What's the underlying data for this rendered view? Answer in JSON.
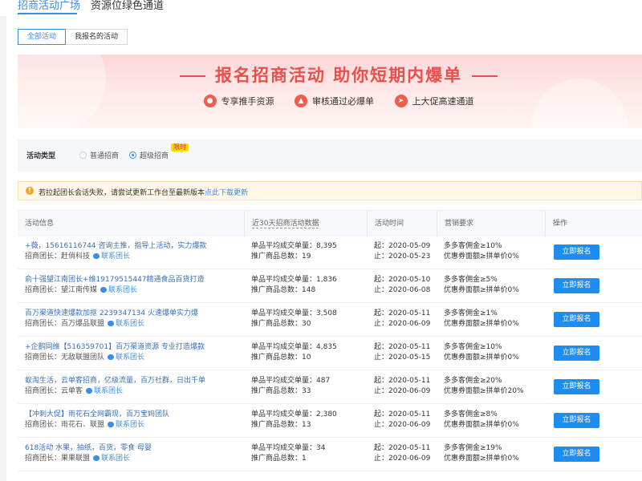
{
  "topnav": {
    "tabs": [
      {
        "label": "招商活动广场",
        "active": true
      },
      {
        "label": "资源位绿色通道",
        "active": false
      }
    ]
  },
  "subtabs": [
    {
      "label": "全部活动",
      "active": true
    },
    {
      "label": "我报名的活动",
      "active": false
    }
  ],
  "banner": {
    "title": "报名招商活动 助你短期内爆单",
    "features": [
      "专享推手资源",
      "审核通过必爆单",
      "上大促高速通道"
    ]
  },
  "activity_type": {
    "label": "活动类型",
    "options": [
      {
        "label": "普通招商",
        "selected": false
      },
      {
        "label": "超级招商",
        "selected": true
      }
    ],
    "badge": "限时"
  },
  "notice": {
    "text": "若拉起团长会话失败，请尝试更新工作台至最新版本",
    "link": "点此下载更新"
  },
  "table": {
    "headers": [
      "活动信息",
      "近30天招商活动数据",
      "活动时间",
      "营销要求",
      "操作"
    ],
    "contact_label": "联系团长",
    "apply_label": "立即报名",
    "leader_prefix": "招商团长：",
    "avg_prefix": "单品平均成交单量：",
    "total_prefix": "推广商品总数：",
    "start_prefix": "起：",
    "end_prefix": "止：",
    "rows": [
      {
        "title": "+薇，15616116744 咨询主推，指导上活动，实力爆款",
        "leader": "赶俏科技",
        "avg": "8,395",
        "total": "19",
        "start": "2020-05-09",
        "end": "2020-05-23",
        "req1": "多多客佣金≥10%",
        "req2": "优惠券面额≥拼单价0%"
      },
      {
        "title": "俞十强望江南团长+维19179515447精通食品百货打造",
        "leader": "望江南传媒",
        "avg": "1,836",
        "total": "148",
        "start": "2020-05-10",
        "end": "2020-06-08",
        "req1": "多多客佣金≥5%",
        "req2": "优惠券面额≥拼单价0%"
      },
      {
        "title": "百万渠道快速爆款加抠 2239347134 火速爆单实力爆",
        "leader": "百万爆品联盟",
        "avg": "3,508",
        "total": "30",
        "start": "2020-05-11",
        "end": "2020-06-09",
        "req1": "多多客佣金≥1%",
        "req2": "优惠券面额≥拼单价0%"
      },
      {
        "title": "+企鹅同维【516359701】百万渠道资源 专业打造爆款",
        "leader": "无敌联盟团队",
        "avg": "4,835",
        "total": "10",
        "start": "2020-05-11",
        "end": "2020-05-15",
        "req1": "多多客佣金≥10%",
        "req2": "优惠券面额≥拼单价0%"
      },
      {
        "title": "蚁淘生活，云单客招商，亿级流量，百万社群，日出千单",
        "leader": "云单客",
        "avg": "487",
        "total": "33",
        "start": "2020-05-11",
        "end": "2020-06-09",
        "req1": "多多客佣金≥20%",
        "req2": "优惠券面额≥拼单价20%"
      },
      {
        "title": "【冲刺大促】雨花石全网霸现，百万宝妈团队",
        "leader": "雨花石、联盟",
        "avg": "2,380",
        "total": "13",
        "start": "2020-05-11",
        "end": "2020-06-09",
        "req1": "多多客佣金≥8%",
        "req2": "优惠券面额≥拼单价0%"
      },
      {
        "title": "618活动 水果，抽纸，百货，零食 母婴",
        "leader": "果果联盟",
        "avg": "34",
        "total": "1",
        "start": "2020-05-11",
        "end": "2020-06-09",
        "req1": "多多客佣金≥19%",
        "req2": "优惠券面额≥拼单价0%"
      }
    ]
  },
  "colors": {
    "accent": "#3a8ee6",
    "banner_title": "#e8504d",
    "button": "#1f8cf0"
  }
}
